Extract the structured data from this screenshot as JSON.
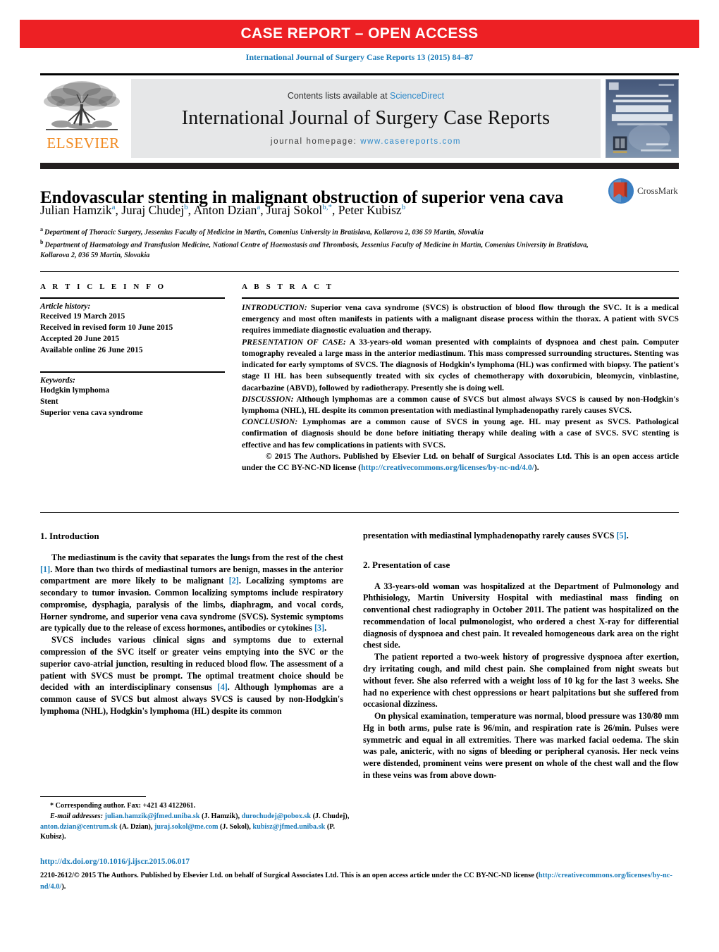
{
  "banner": {
    "label": "CASE REPORT – OPEN ACCESS",
    "color": "#ED2024"
  },
  "citation": "International Journal of Surgery Case Reports 13 (2015) 84–87",
  "journal_header": {
    "publisher_name": "ELSEVIER",
    "publisher_color": "#F18A21",
    "contents_prefix": "Contents lists available at ",
    "contents_link": "ScienceDirect",
    "journal_title": "International Journal of Surgery Case Reports",
    "homepage_prefix": "journal homepage: ",
    "homepage_url": "www.casereports.com",
    "link_color": "#2E8ACA",
    "cover": {
      "line1": "INTERNATIONAL",
      "line2": "JOURNAL OF SURGERY",
      "line3": "CASE",
      "line4": "REPORTS",
      "tagline": "A free open access scientific journal",
      "publisher": "Elsevier",
      "url": "www.casereports.com"
    }
  },
  "article": {
    "title": "Endovascular stenting in malignant obstruction of superior vena cava",
    "crossmark_label": "CrossMark",
    "authors": [
      {
        "name": "Julian Hamzik",
        "marks": "a",
        "sep": ", "
      },
      {
        "name": "Juraj Chudej",
        "marks": "b",
        "sep": ", "
      },
      {
        "name": "Anton Dzian",
        "marks": "a",
        "sep": ", "
      },
      {
        "name": "Juraj Sokol",
        "marks": "b,*",
        "sep": ", "
      },
      {
        "name": "Peter Kubisz",
        "marks": "b",
        "sep": ""
      }
    ],
    "affiliations": [
      {
        "mark": "a",
        "text": "Department of Thoracic Surgery, Jessenius Faculty of Medicine in Martin, Comenius University in Bratislava, Kollarova 2, 036 59 Martin, Slovakia"
      },
      {
        "mark": "b",
        "text": "Department of Haematology and Transfusion Medicine, National Centre of Haemostasis and Thrombosis, Jessenius Faculty of Medicine in Martin, Comenius University in Bratislava, Kollarova 2, 036 59 Martin, Slovakia"
      }
    ]
  },
  "article_info": {
    "heading": "A R T I C L E   I N F O",
    "history_label": "Article history:",
    "history": [
      "Received 19 March 2015",
      "Received in revised form 10 June 2015",
      "Accepted 20 June 2015",
      "Available online 26 June 2015"
    ],
    "keywords_label": "Keywords:",
    "keywords": [
      "Hodgkin lymphoma",
      "Stent",
      "Superior vena cava syndrome"
    ]
  },
  "abstract": {
    "heading": "A B S T R A C T",
    "sections": [
      {
        "label": "INTRODUCTION:",
        "text": " Superior vena cava syndrome (SVCS) is obstruction of blood flow through the SVC. It is a medical emergency and most often manifests in patients with a malignant disease process within the thorax. A patient with SVCS requires immediate diagnostic evaluation and therapy."
      },
      {
        "label": "PRESENTATION OF CASE:",
        "text": " A 33-years-old woman presented with complaints of dyspnoea and chest pain. Computer tomography revealed a large mass in the anterior mediastinum. This mass compressed surrounding structures. Stenting was indicated for early symptoms of SVCS. The diagnosis of Hodgkin's lymphoma (HL) was confirmed with biopsy. The patient's stage II HL has been subsequently treated with six cycles of chemotherapy with doxorubicin, bleomycin, vinblastine, dacarbazine (ABVD), followed by radiotherapy. Presently she is doing well."
      },
      {
        "label": "DISCUSSION:",
        "text": " Although lymphomas are a common cause of SVCS but almost always SVCS is caused by non-Hodgkin's lymphoma (NHL), HL despite its common presentation with mediastinal lymphadenopathy rarely causes SVCS."
      },
      {
        "label": "CONCLUSION:",
        "text": " Lymphomas are a common cause of SVCS in young age. HL may present as SVCS. Pathological confirmation of diagnosis should be done before initiating therapy while dealing with a case of SVCS. SVC stenting is effective and has few complications in patients with SVCS."
      }
    ],
    "copyright_text": "© 2015 The Authors. Published by Elsevier Ltd. on behalf of Surgical Associates Ltd. This is an open access article under the CC BY-NC-ND license (",
    "copyright_link": "http://creativecommons.org/licenses/by-nc-nd/4.0/",
    "copyright_tail": ")."
  },
  "body": {
    "left": {
      "section_heading": "1.  Introduction",
      "paragraphs": [
        {
          "parts": [
            {
              "t": "The mediastinum is the cavity that separates the lungs from the rest of the chest "
            },
            {
              "t": "[1]",
              "ref": true
            },
            {
              "t": ". More than two thirds of mediastinal tumors are benign, masses in the anterior compartment are more likely to be malignant "
            },
            {
              "t": "[2]",
              "ref": true
            },
            {
              "t": ". Localizing symptoms are secondary to tumor invasion. Common localizing symptoms include respiratory compromise, dysphagia, paralysis of the limbs, diaphragm, and vocal cords, Horner syndrome, and superior vena cava syndrome (SVCS). Systemic symptoms are typically due to the release of excess hormones, antibodies or cytokines "
            },
            {
              "t": "[3]",
              "ref": true
            },
            {
              "t": "."
            }
          ]
        },
        {
          "parts": [
            {
              "t": "SVCS includes various clinical signs and symptoms due to external compression of the SVC itself or greater veins emptying into the SVC or the superior cavo-atrial junction, resulting in reduced blood flow. The assessment of a patient with SVCS must be prompt. The optimal treatment choice should be decided with an interdisciplinary consensus "
            },
            {
              "t": "[4]",
              "ref": true
            },
            {
              "t": ". Although lymphomas are a common cause of SVCS but almost always SVCS is caused by non-Hodgkin's lymphoma (NHL), Hodgkin's lymphoma (HL) despite its common"
            }
          ]
        }
      ]
    },
    "right": {
      "continuation": {
        "parts": [
          {
            "t": "presentation with mediastinal lymphadenopathy rarely causes SVCS "
          },
          {
            "t": "[5]",
            "ref": true
          },
          {
            "t": "."
          }
        ]
      },
      "section_heading": "2.  Presentation of case",
      "paragraphs": [
        {
          "parts": [
            {
              "t": "A 33-years-old woman was hospitalized at the Department of Pulmonology and Phthisiology, Martin University Hospital with mediastinal mass finding on conventional chest radiography in October 2011. The patient was hospitalized on the recommendation of local pulmonologist, who ordered a chest X-ray for differential diagnosis of dyspnoea and chest pain. It revealed homogeneous dark area on the right chest side."
            }
          ]
        },
        {
          "parts": [
            {
              "t": "The patient reported a two-week history of progressive dyspnoea after exertion, dry irritating cough, and mild chest pain. She complained from night sweats but without fever. She also referred with a weight loss of 10 kg for the last 3 weeks. She had no experience with chest oppressions or heart palpitations but she suffered from occasional dizziness."
            }
          ]
        },
        {
          "parts": [
            {
              "t": "On physical examination, temperature was normal, blood pressure was 130/80 mm Hg in both arms, pulse rate is 96/min, and respiration rate is 26/min. Pulses were symmetric and equal in all extremities. There was marked facial oedema. The skin was pale, anicteric, with no signs of bleeding or peripheral cyanosis. Her neck veins were distended, prominent veins were present on whole of the chest wall and the flow in these veins was from above down-"
            }
          ]
        }
      ]
    }
  },
  "footnote": {
    "corresponding": "* Corresponding author. Fax: +421 43 4122061.",
    "email_label": "E-mail addresses:",
    "emails": [
      {
        "address": "julian.hamzik@jfmed.uniba.sk",
        "owner": "(J. Hamzik)",
        "sep": ", "
      },
      {
        "address": "durochudej@pobox.sk",
        "owner": "(J. Chudej)",
        "sep": ", "
      },
      {
        "address": "anton.dzian@centrum.sk",
        "owner": "(A. Dzian)",
        "sep": ", "
      },
      {
        "address": "juraj.sokol@me.com",
        "owner": "(J. Sokol)",
        "sep": ", "
      },
      {
        "address": "kubisz@jfmed.uniba.sk",
        "owner": "(P. Kubisz)",
        "sep": "."
      }
    ],
    "doi": "http://dx.doi.org/10.1016/j.ijscr.2015.06.017",
    "issn_text": "2210-2612/© 2015 The Authors. Published by Elsevier Ltd. on behalf of Surgical Associates Ltd. This is an open access article under the CC BY-NC-ND license (",
    "issn_link": "http://creativecommons.org/licenses/by-nc-nd/4.0/",
    "issn_tail": ")."
  }
}
